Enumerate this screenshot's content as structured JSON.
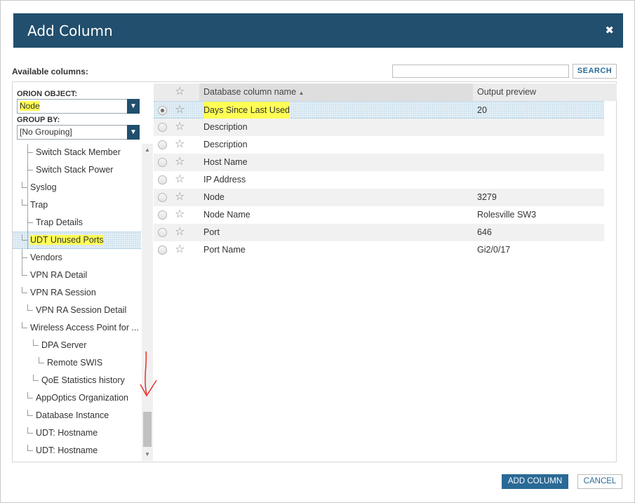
{
  "dialog": {
    "title": "Add Column",
    "close_symbol": "✖",
    "available_label": "Available columns:",
    "search": {
      "value": "",
      "placeholder": "",
      "button_label": "SEARCH"
    }
  },
  "left": {
    "orion_object_label": "ORION OBJECT:",
    "orion_object_value": "Node",
    "group_by_label": "GROUP BY:",
    "group_by_value": "[No Grouping]",
    "tree": [
      "Switch Stack Member",
      "Switch Stack Power",
      "Syslog",
      "Trap",
      "Trap Details",
      "UDT Unused Ports",
      "Vendors",
      "VPN RA Detail",
      "VPN RA Session",
      "VPN RA Session Detail",
      "Wireless Access Point for ...",
      "DPA Server",
      "Remote SWIS",
      "QoE Statistics history",
      "AppOptics Organization",
      "Database Instance",
      "UDT: Hostname",
      "UDT: Hostname"
    ],
    "selected_tree_item": "UDT Unused Ports"
  },
  "grid": {
    "headers": {
      "name": "Database column name",
      "sort_indicator": "▲",
      "preview": "Output preview"
    },
    "rows": [
      {
        "name": "Days Since Last Used",
        "preview": "20",
        "selected": true
      },
      {
        "name": "Description",
        "preview": ""
      },
      {
        "name": "Description",
        "preview": ""
      },
      {
        "name": "Host Name",
        "preview": ""
      },
      {
        "name": "IP Address",
        "preview": ""
      },
      {
        "name": "Node",
        "preview": "3279"
      },
      {
        "name": "Node Name",
        "preview": "Rolesville SW3"
      },
      {
        "name": "Port",
        "preview": "646"
      },
      {
        "name": "Port Name",
        "preview": "Gi2/0/17"
      }
    ]
  },
  "footer": {
    "add_label": "ADD COLUMN",
    "cancel_label": "CANCEL"
  },
  "colors": {
    "header": "#214f6d",
    "accent": "#2a6a96",
    "highlight": "#ffff55",
    "annotation": "#e8332a"
  }
}
